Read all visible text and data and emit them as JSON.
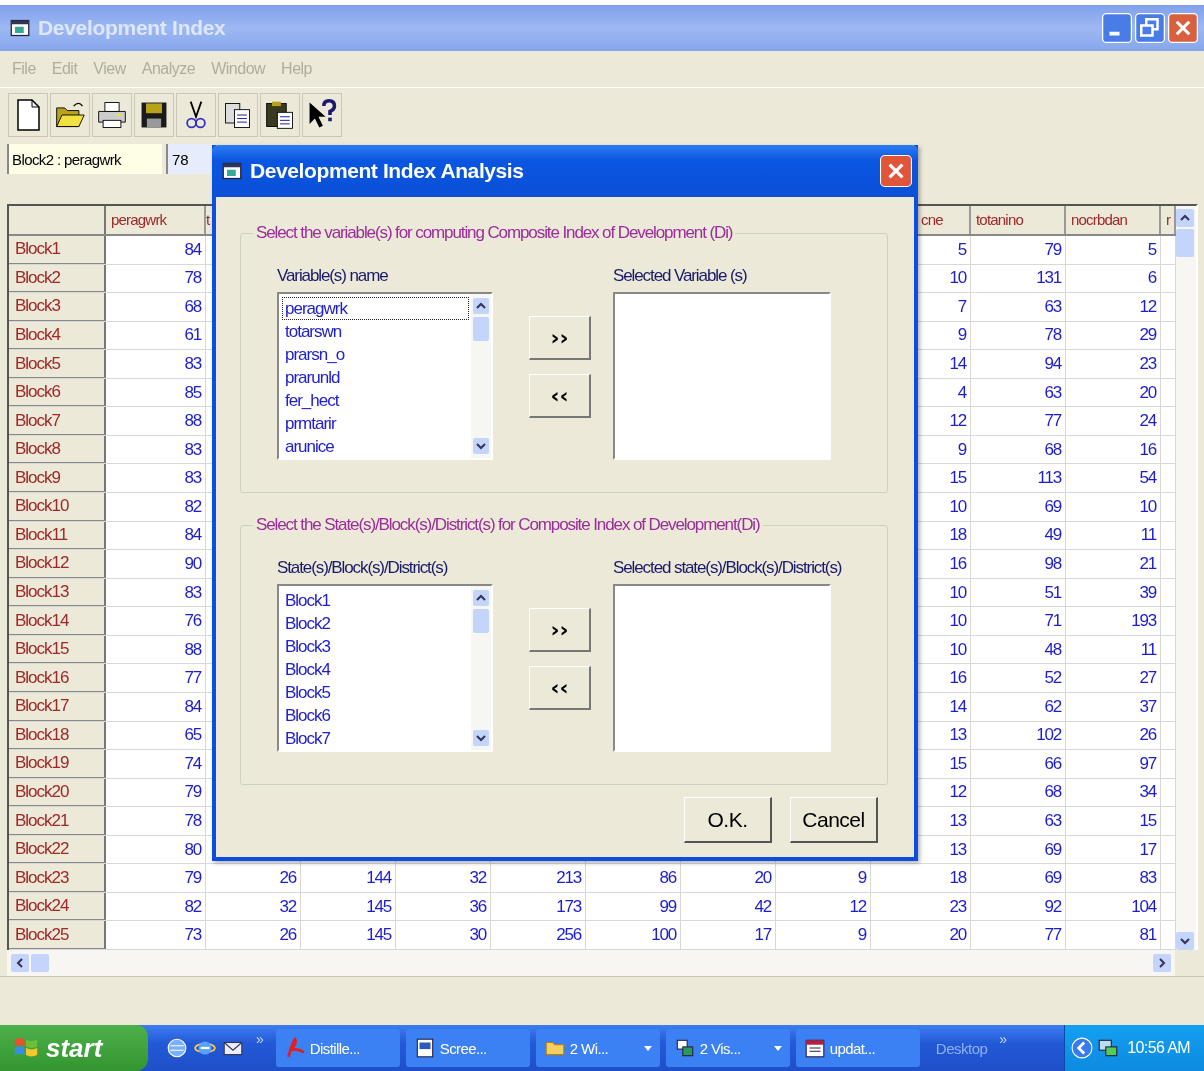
{
  "window": {
    "title": "Development Index"
  },
  "menu": [
    {
      "label": "File",
      "disabled": true
    },
    {
      "label": "Edit",
      "disabled": true
    },
    {
      "label": "View",
      "disabled": true
    },
    {
      "label": "Analyze",
      "disabled": true
    },
    {
      "label": "Window",
      "disabled": true
    },
    {
      "label": "Help",
      "disabled": true
    }
  ],
  "cell_reference": {
    "name": "Block2 : peragwrk",
    "value": "78"
  },
  "table": {
    "columns": [
      "peragwrk",
      "t",
      null,
      null,
      null,
      null,
      null,
      null,
      "cne",
      "totanino",
      "nocrbdan",
      "r"
    ],
    "rows": [
      {
        "header": "Block1",
        "cells": [
          "84",
          null,
          null,
          null,
          null,
          null,
          null,
          null,
          "5",
          "79",
          "5"
        ]
      },
      {
        "header": "Block2",
        "cells": [
          "78",
          null,
          null,
          null,
          null,
          null,
          null,
          null,
          "10",
          "131",
          "6"
        ]
      },
      {
        "header": "Block3",
        "cells": [
          "68",
          null,
          null,
          null,
          null,
          null,
          null,
          null,
          "7",
          "63",
          "12"
        ]
      },
      {
        "header": "Block4",
        "cells": [
          "61",
          null,
          null,
          null,
          null,
          null,
          null,
          null,
          "9",
          "78",
          "29"
        ]
      },
      {
        "header": "Block5",
        "cells": [
          "83",
          null,
          null,
          null,
          null,
          null,
          null,
          null,
          "14",
          "94",
          "23"
        ]
      },
      {
        "header": "Block6",
        "cells": [
          "85",
          null,
          null,
          null,
          null,
          null,
          null,
          null,
          "4",
          "63",
          "20"
        ]
      },
      {
        "header": "Block7",
        "cells": [
          "88",
          null,
          null,
          null,
          null,
          null,
          null,
          null,
          "12",
          "77",
          "24"
        ]
      },
      {
        "header": "Block8",
        "cells": [
          "83",
          null,
          null,
          null,
          null,
          null,
          null,
          null,
          "9",
          "68",
          "16"
        ]
      },
      {
        "header": "Block9",
        "cells": [
          "83",
          null,
          null,
          null,
          null,
          null,
          null,
          null,
          "15",
          "113",
          "54"
        ]
      },
      {
        "header": "Block10",
        "cells": [
          "82",
          null,
          null,
          null,
          null,
          null,
          null,
          null,
          "10",
          "69",
          "10"
        ]
      },
      {
        "header": "Block11",
        "cells": [
          "84",
          null,
          null,
          null,
          null,
          null,
          null,
          null,
          "18",
          "49",
          "11"
        ]
      },
      {
        "header": "Block12",
        "cells": [
          "90",
          null,
          null,
          null,
          null,
          null,
          null,
          null,
          "16",
          "98",
          "21"
        ]
      },
      {
        "header": "Block13",
        "cells": [
          "83",
          null,
          null,
          null,
          null,
          null,
          null,
          null,
          "10",
          "51",
          "39"
        ]
      },
      {
        "header": "Block14",
        "cells": [
          "76",
          null,
          null,
          null,
          null,
          null,
          null,
          null,
          "10",
          "71",
          "193"
        ]
      },
      {
        "header": "Block15",
        "cells": [
          "88",
          null,
          null,
          null,
          null,
          null,
          null,
          null,
          "10",
          "48",
          "11"
        ]
      },
      {
        "header": "Block16",
        "cells": [
          "77",
          null,
          null,
          null,
          null,
          null,
          null,
          null,
          "16",
          "52",
          "27"
        ]
      },
      {
        "header": "Block17",
        "cells": [
          "84",
          null,
          null,
          null,
          null,
          null,
          null,
          null,
          "14",
          "62",
          "37"
        ]
      },
      {
        "header": "Block18",
        "cells": [
          "65",
          null,
          null,
          null,
          null,
          null,
          null,
          null,
          "13",
          "102",
          "26"
        ]
      },
      {
        "header": "Block19",
        "cells": [
          "74",
          null,
          null,
          null,
          null,
          null,
          null,
          null,
          "15",
          "66",
          "97"
        ]
      },
      {
        "header": "Block20",
        "cells": [
          "79",
          null,
          null,
          null,
          null,
          null,
          null,
          null,
          "12",
          "68",
          "34"
        ]
      },
      {
        "header": "Block21",
        "cells": [
          "78",
          null,
          null,
          null,
          null,
          null,
          null,
          null,
          "13",
          "63",
          "15"
        ]
      },
      {
        "header": "Block22",
        "cells": [
          "80",
          null,
          null,
          null,
          null,
          null,
          null,
          null,
          "13",
          "69",
          "17"
        ]
      },
      {
        "header": "Block23",
        "cells": [
          "79",
          "26",
          "144",
          "32",
          "213",
          "86",
          "20",
          "9",
          "18",
          "69",
          "83"
        ]
      },
      {
        "header": "Block24",
        "cells": [
          "82",
          "32",
          "145",
          "36",
          "173",
          "99",
          "42",
          "12",
          "23",
          "92",
          "104"
        ]
      },
      {
        "header": "Block25",
        "cells": [
          "73",
          "26",
          "145",
          "30",
          "256",
          "100",
          "17",
          "9",
          "20",
          "77",
          "81"
        ]
      }
    ]
  },
  "dialog": {
    "title": "Development Index Analysis",
    "groups": [
      {
        "legend": "Select the variable(s) for computing Composite Index of Development (Di)",
        "source_label": "Variable(s) name",
        "target_label": "Selected Variable (s)",
        "items": [
          {
            "label": "peragwrk",
            "focused": true
          },
          {
            "label": "totarswn",
            "focused": false
          },
          {
            "label": "prarsn_o",
            "focused": false
          },
          {
            "label": "prarunld",
            "focused": false
          },
          {
            "label": "fer_hect",
            "focused": false
          },
          {
            "label": "prmtarir",
            "focused": false
          },
          {
            "label": "arunice",
            "focused": false
          }
        ],
        "add_button": "››",
        "remove_button": "‹‹"
      },
      {
        "legend": "Select the State(s)/Block(s)/District(s) for Composite Index of Development(Di)",
        "source_label": "State(s)/Block(s)/District(s)",
        "target_label": "Selected state(s)/Block(s)/District(s)",
        "items": [
          {
            "label": "Block1",
            "focused": false
          },
          {
            "label": "Block2",
            "focused": false
          },
          {
            "label": "Block3",
            "focused": false
          },
          {
            "label": "Block4",
            "focused": false
          },
          {
            "label": "Block5",
            "focused": false
          },
          {
            "label": "Block6",
            "focused": false
          },
          {
            "label": "Block7",
            "focused": false
          }
        ],
        "add_button": "››",
        "remove_button": "‹‹"
      }
    ],
    "buttons": [
      "O.K.",
      "Cancel"
    ]
  },
  "taskbar": {
    "start": "start",
    "quick_launch_more": "»",
    "tasks": [
      {
        "label": "Distille...",
        "has_menu": false
      },
      {
        "label": "Scree...",
        "has_menu": false
      },
      {
        "label": "2 Wi...",
        "has_menu": true
      },
      {
        "label": "2 Vis...",
        "has_menu": true
      },
      {
        "label": "updat...",
        "has_menu": false
      }
    ],
    "desktop_toolbar": "Desktop",
    "toolbar_more": "»",
    "clock": "10:56 AM"
  }
}
